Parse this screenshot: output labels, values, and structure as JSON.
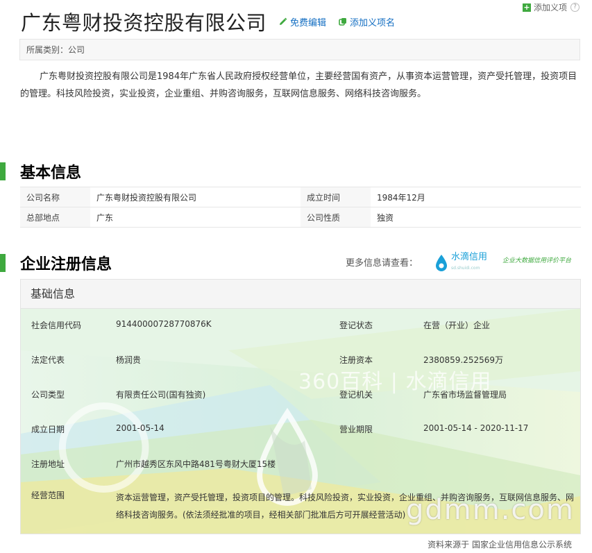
{
  "top_action": {
    "add_term_label": "添加义项"
  },
  "header": {
    "title": "广东粤财投资控股有限公司",
    "edit_label": "免费编辑",
    "add_name_label": "添加义项名"
  },
  "category": {
    "text": "所属类别：公司"
  },
  "summary": "广东粤财投资控股有限公司是1984年广东省人民政府授权经营单位，主要经营国有资产，从事资本运营管理，资产受托管理，投资项目的管理。科技风险投资，实业投资，企业重组、并购咨询服务，互联网信息服务、网络科技咨询服务。",
  "basic_info": {
    "title": "基本信息",
    "rows": [
      {
        "k1": "公司名称",
        "v1": "广东粤财投资控股有限公司",
        "k2": "成立时间",
        "v2": "1984年12月"
      },
      {
        "k1": "总部地点",
        "v1": "广东",
        "k2": "公司性质",
        "v2": "独资"
      }
    ]
  },
  "registration": {
    "title": "企业注册信息",
    "more_info_label": "更多信息请查看：",
    "partner_name": "水滴信用",
    "partner_sub": "sd.shuidi.com",
    "partner_slogan": "企业大数据信用评价平台",
    "box_title": "基础信息",
    "watermark": "360百科 | 水滴信用",
    "rows": [
      {
        "k1": "社会信用代码",
        "v1": "91440000728770876K",
        "k2": "登记状态",
        "v2": "在营（开业）企业"
      },
      {
        "k1": "法定代表",
        "v1": "杨润贵",
        "k2": "注册资本",
        "v2": "2380859.252569万"
      },
      {
        "k1": "公司类型",
        "v1": "有限责任公司(国有独资)",
        "k2": "登记机关",
        "v2": "广东省市场监督管理局"
      },
      {
        "k1": "成立日期",
        "v1": "2001-05-14",
        "k2": "营业期限",
        "v2": "2001-05-14 - 2020-11-17"
      },
      {
        "k1": "注册地址",
        "v1": "广州市越秀区东风中路481号粤财大厦15楼",
        "k2": "",
        "v2": ""
      }
    ],
    "scope_label": "经营范围",
    "scope_text": "资本运营管理，资产受托管理，投资项目的管理。科技风险投资，实业投资，企业重组、并购咨询服务，互联网信息服务、网络科技咨询服务。(依法须经批准的项目，经相关部门批准后方可开展经营活动)"
  },
  "footer": {
    "source": "资料来源于 国家企业信用信息公示系统"
  },
  "overlay_watermark": "gdmm.com",
  "colors": {
    "accent_green": "#3fa93f",
    "link_blue": "#136ec2",
    "partner_blue": "#1aa0d8"
  }
}
